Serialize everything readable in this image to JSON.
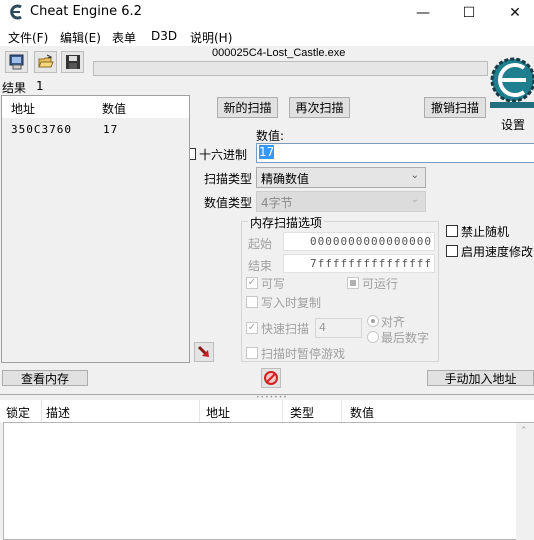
{
  "window": {
    "title": "Cheat Engine 6.2",
    "minimize_symbol": "—",
    "maximize_symbol": "☐",
    "close_symbol": "✕"
  },
  "menu": [
    {
      "label": "文件(F)"
    },
    {
      "label": "编辑(E)"
    },
    {
      "label": "表单"
    },
    {
      "label": "D3D"
    },
    {
      "label": "说明(H)"
    }
  ],
  "toolbar": {
    "icons": [
      "select-process-icon",
      "open-folder-icon",
      "save-disk-icon"
    ],
    "process_name": "000025C4-Lost_Castle.exe"
  },
  "results": {
    "label": "结果",
    "count": "1",
    "columns": [
      "地址",
      "数值"
    ],
    "rows": [
      {
        "address": "350C3760",
        "value": "17"
      }
    ]
  },
  "scan": {
    "new_scan": "新的扫描",
    "next_scan": "再次扫描",
    "undo_scan": "撤销扫描",
    "settings": "设置",
    "value_label": "数值:",
    "hex_label": "十六进制",
    "value": "17",
    "scan_type_label": "扫描类型",
    "scan_type": "精确数值",
    "value_type_label": "数值类型",
    "value_type": "4字节"
  },
  "memory_options": {
    "title": "内存扫描选项",
    "start_label": "起始",
    "start_value": "0000000000000000",
    "end_label": "结束",
    "end_value": "7fffffffffffffff",
    "writable": {
      "label": "可写",
      "checked": true
    },
    "executable": {
      "label": "可运行",
      "state": "indeterminate"
    },
    "copy_on_write": {
      "label": "写入时复制",
      "checked": false
    },
    "fast_scan": {
      "label": "快速扫描",
      "checked": true,
      "value": "4"
    },
    "align": {
      "label": "对齐",
      "selected": true
    },
    "last_digits": {
      "label": "最后数字",
      "selected": false
    },
    "pause_game": {
      "label": "扫描时暂停游戏",
      "checked": false
    }
  },
  "extra_options": {
    "disable_random": {
      "label": "禁止随机",
      "checked": false
    },
    "speedhack": {
      "label": "启用速度修改",
      "checked": false
    }
  },
  "bottom": {
    "view_memory": "查看内存",
    "add_address": "手动加入地址"
  },
  "address_table": {
    "columns": [
      "锁定",
      "描述",
      "地址",
      "类型",
      "数值"
    ],
    "rows": []
  }
}
